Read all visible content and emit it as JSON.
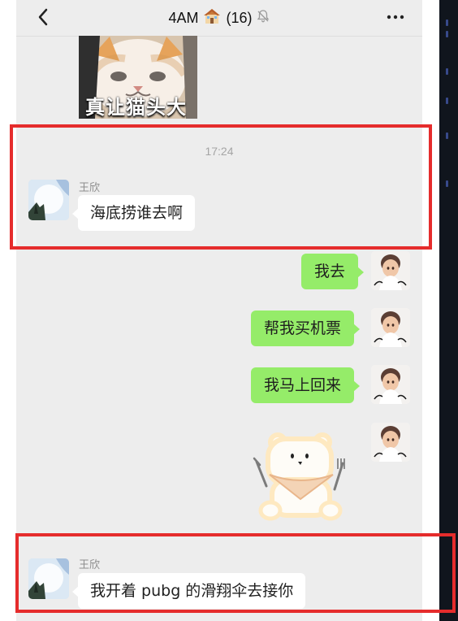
{
  "header": {
    "title": "4AM",
    "title_icon": "house-emoji",
    "member_count": "(16)",
    "mute_icon": "bell-slash-icon",
    "back_icon": "chevron-left-icon",
    "more_icon": "more-dots-icon"
  },
  "sticker_top": {
    "caption": "真让猫头大"
  },
  "time_label": "17:24",
  "messages": [
    {
      "sender": "王欣",
      "side": "left",
      "text": "海底捞谁去啊"
    },
    {
      "sender": "",
      "side": "right",
      "text": "我去"
    },
    {
      "sender": "",
      "side": "right",
      "text": "帮我买机票"
    },
    {
      "sender": "",
      "side": "right",
      "text": "我马上回来"
    },
    {
      "sender": "",
      "side": "right",
      "sticker": "bear-sticker"
    },
    {
      "sender": "王欣",
      "side": "left",
      "text": "我开着 pubg 的滑翔伞去接你"
    }
  ],
  "colors": {
    "chat_background": "#EDEDED",
    "left_bubble": "#FFFFFF",
    "right_bubble": "#95EC69",
    "highlight_box": "#E52C2C",
    "side_panel": "#10151D"
  }
}
